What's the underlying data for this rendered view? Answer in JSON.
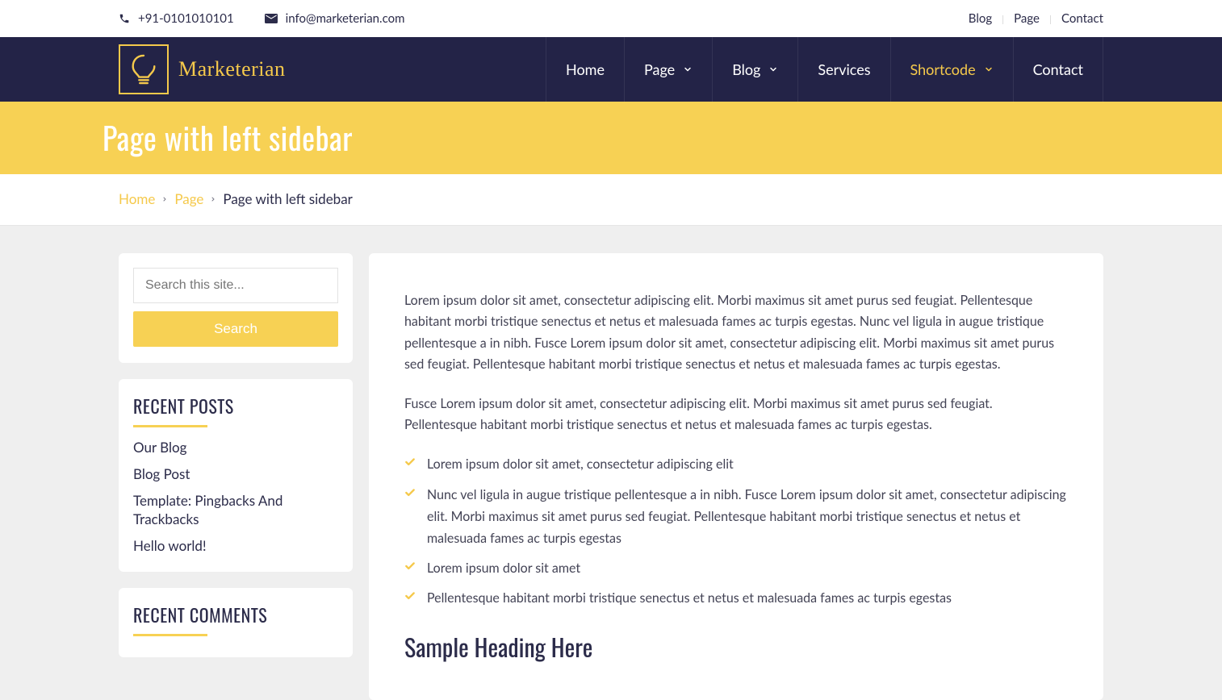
{
  "topbar": {
    "phone": "+91-0101010101",
    "email": "info@marketerian.com",
    "links": [
      "Blog",
      "Page",
      "Contact"
    ]
  },
  "brand": {
    "name": "Marketerian"
  },
  "nav": {
    "items": [
      {
        "label": "Home",
        "dropdown": false,
        "active": false
      },
      {
        "label": "Page",
        "dropdown": true,
        "active": false
      },
      {
        "label": "Blog",
        "dropdown": true,
        "active": false
      },
      {
        "label": "Services",
        "dropdown": false,
        "active": false
      },
      {
        "label": "Shortcode",
        "dropdown": true,
        "active": true
      },
      {
        "label": "Contact",
        "dropdown": false,
        "active": false
      }
    ]
  },
  "page_title": "Page with left sidebar",
  "breadcrumb": {
    "items": [
      {
        "label": "Home",
        "link": true
      },
      {
        "label": "Page",
        "link": true
      },
      {
        "label": "Page with left sidebar",
        "link": false
      }
    ]
  },
  "sidebar": {
    "search": {
      "placeholder": "Search this site...",
      "button": "Search"
    },
    "recent_posts": {
      "title": "RECENT POSTS",
      "items": [
        "Our Blog",
        "Blog Post",
        "Template: Pingbacks And Trackbacks",
        "Hello world!"
      ]
    },
    "recent_comments": {
      "title": "RECENT COMMENTS"
    }
  },
  "content": {
    "p1": "Lorem ipsum dolor sit amet, consectetur adipiscing elit. Morbi maximus sit amet purus sed feugiat. Pellentesque habitant morbi tristique senectus et netus et malesuada fames ac turpis egestas. Nunc vel ligula in augue tristique pellentesque a in nibh. Fusce Lorem ipsum dolor sit amet, consectetur adipiscing elit. Morbi maximus sit amet purus sed feugiat. Pellentesque habitant morbi tristique senectus et netus et malesuada fames ac turpis egestas.",
    "p2": "Fusce Lorem ipsum dolor sit amet, consectetur adipiscing elit. Morbi maximus sit amet purus sed feugiat. Pellentesque habitant morbi tristique senectus et netus et malesuada fames ac turpis egestas.",
    "bullets": [
      "Lorem ipsum dolor sit amet, consectetur adipiscing elit",
      "Nunc vel ligula in augue tristique pellentesque a in nibh. Fusce Lorem ipsum dolor sit amet, consectetur adipiscing elit. Morbi maximus sit amet purus sed feugiat. Pellentesque habitant morbi tristique senectus et netus et malesuada fames ac turpis egestas",
      "Lorem ipsum dolor sit amet",
      "Pellentesque habitant morbi tristique senectus et netus et malesuada fames ac turpis egestas"
    ],
    "heading": "Sample Heading Here"
  }
}
